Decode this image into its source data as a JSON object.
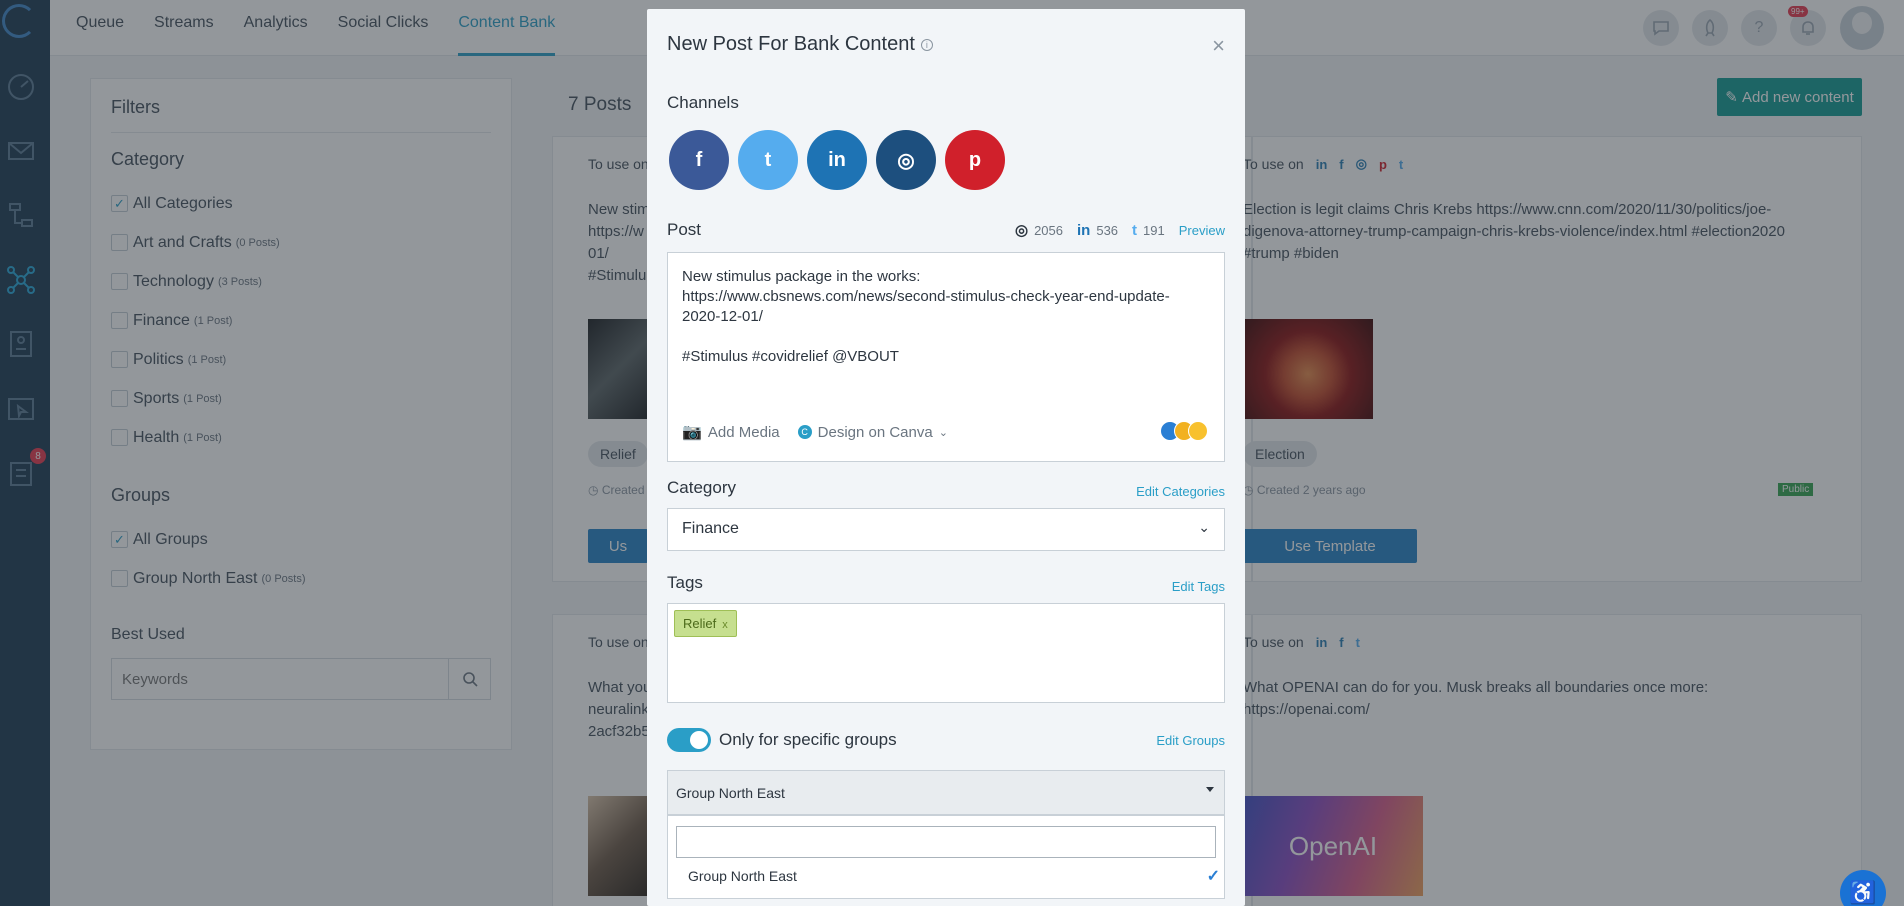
{
  "nav": {
    "items": [
      "Queue",
      "Streams",
      "Analytics",
      "Social Clicks",
      "Content Bank"
    ],
    "active_index": 4
  },
  "topbar": {
    "notif_badge": "99+"
  },
  "sidebar": {
    "badge_count": "8"
  },
  "filters": {
    "title": "Filters",
    "category_heading": "Category",
    "categories": [
      {
        "label": "All Categories",
        "count": "",
        "checked": true
      },
      {
        "label": "Art and Crafts",
        "count": "(0 Posts)",
        "checked": false
      },
      {
        "label": "Technology",
        "count": "(3 Posts)",
        "checked": false
      },
      {
        "label": "Finance",
        "count": "(1 Post)",
        "checked": false
      },
      {
        "label": "Politics",
        "count": "(1 Post)",
        "checked": false
      },
      {
        "label": "Sports",
        "count": "(1 Post)",
        "checked": false
      },
      {
        "label": "Health",
        "count": "(1 Post)",
        "checked": false
      }
    ],
    "groups_heading": "Groups",
    "groups": [
      {
        "label": "All Groups",
        "count": "",
        "checked": true
      },
      {
        "label": "Group North East",
        "count": "(0 Posts)",
        "checked": false
      }
    ],
    "best_used_heading": "Best Used",
    "keyword_placeholder": "Keywords"
  },
  "main": {
    "posts_count": "7 Posts",
    "add_button": "Add new content",
    "cards": [
      {
        "to_use_on": "To use on",
        "text": "New stim\nhttps://w\n01/\n#Stimulu",
        "tag": "Relief",
        "created": "Created",
        "use": "Us"
      },
      {
        "to_use_on": "To use on",
        "text": "Election is legit claims Chris Krebs https://www.cnn.com/2020/11/30/politics/joe-digenova-attorney-trump-campaign-chris-krebs-violence/index.html #election2020 #trump #biden",
        "tag": "Election",
        "created": "Created 2 years ago",
        "public": "Public",
        "use": "Use Template"
      },
      {
        "to_use_on": "To use on",
        "text": "What you\nneuralink\n2acf32b5"
      },
      {
        "to_use_on": "To use on",
        "text": "What OPENAI can do for you. Musk breaks all boundaries once more: https://openai.com/",
        "image_text": "OpenAI"
      }
    ]
  },
  "modal": {
    "title": "New Post For Bank Content",
    "channels_label": "Channels",
    "channels": [
      {
        "name": "facebook",
        "glyph": "f",
        "color": "#3b5998"
      },
      {
        "name": "twitter",
        "glyph": "t",
        "color": "#55acee"
      },
      {
        "name": "linkedin",
        "glyph": "in",
        "color": "#1e73b4"
      },
      {
        "name": "instagram",
        "glyph": "◎",
        "color": "#1d4f7e"
      },
      {
        "name": "pinterest",
        "glyph": "p",
        "color": "#d0202b"
      }
    ],
    "post_label": "Post",
    "counts": {
      "instagram": "2056",
      "linkedin": "536",
      "twitter": "191"
    },
    "preview": "Preview",
    "post_text": "New stimulus package in the works:\nhttps://www.cbsnews.com/news/second-stimulus-check-year-end-update-2020-12-01/\n\n#Stimulus #covidrelief @VBOUT",
    "add_media": "Add Media",
    "design_canva": "Design on Canva",
    "category_label": "Category",
    "edit_categories": "Edit Categories",
    "category_value": "Finance",
    "tags_label": "Tags",
    "edit_tags": "Edit Tags",
    "tag_chip": "Relief",
    "toggle_label": "Only for specific groups",
    "toggle_on": true,
    "edit_groups": "Edit Groups",
    "group_value": "Group North East",
    "dropdown_option": "Group North East"
  }
}
